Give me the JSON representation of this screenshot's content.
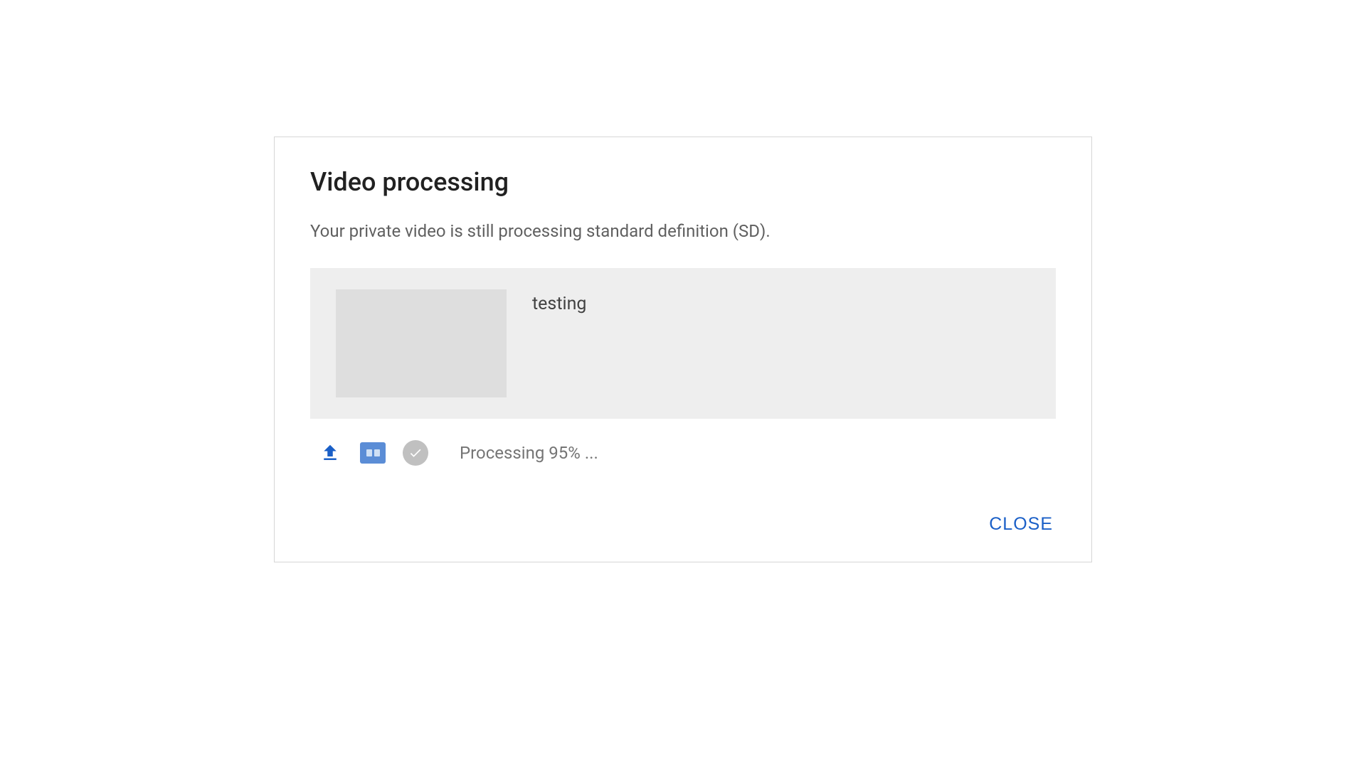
{
  "dialog": {
    "title": "Video processing",
    "subtitle": "Your private video is still processing standard definition (SD).",
    "video": {
      "title": "testing"
    },
    "status": {
      "text": "Processing 95% ..."
    },
    "actions": {
      "close_label": "CLOSE"
    }
  }
}
